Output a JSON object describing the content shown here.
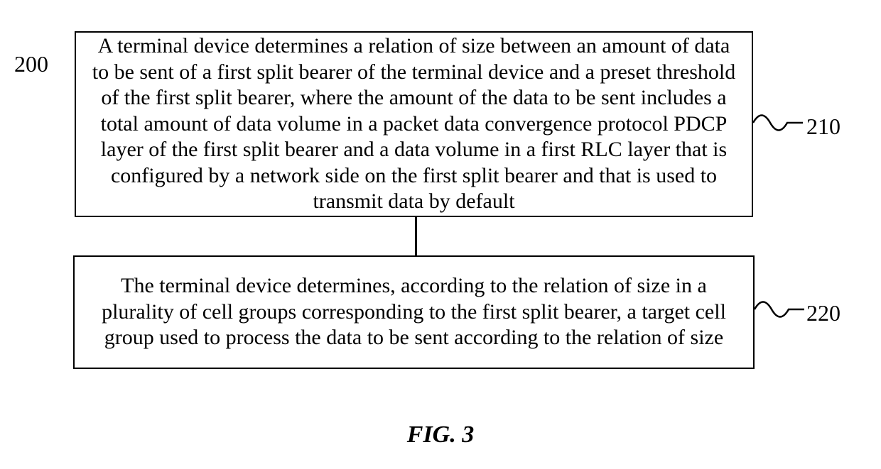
{
  "diagram": {
    "ref_label_200": "200",
    "step_210": {
      "text": "A terminal device determines a relation of size between an amount of data to be sent of a first split bearer of the terminal device and a preset threshold of the first split bearer, where the amount of the data to be sent includes a total amount of data volume in a packet data convergence protocol PDCP layer of the first split bearer and a data volume in a first RLC layer that is configured by a network side on the first split bearer and that is used to transmit data by default",
      "ref": "210"
    },
    "step_220": {
      "text": "The terminal device determines, according to the relation of size in a plurality of cell groups corresponding to the first split bearer, a target cell group used to process the data to be sent according to the relation of size",
      "ref": "220"
    },
    "caption": "FIG. 3"
  }
}
